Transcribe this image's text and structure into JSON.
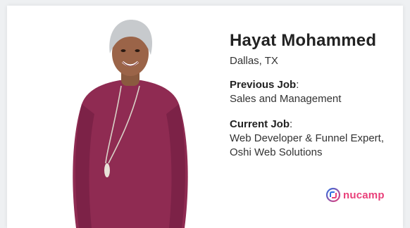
{
  "profile": {
    "name": "Hayat Mohammed",
    "location": "Dallas, TX",
    "previous_label": "Previous Job",
    "previous_value": "Sales and Management",
    "current_label": "Current Job",
    "current_value_line1": "Web Developer & Funnel Expert,",
    "current_value_line2": "Oshi Web Solutions",
    "colon": ":"
  },
  "brand": {
    "name": "nucamp",
    "primary_color": "#e9407a",
    "secondary_color": "#2e6fe0"
  },
  "icons": {
    "logo": "nucamp-logo-icon",
    "portrait": "person-portrait"
  }
}
